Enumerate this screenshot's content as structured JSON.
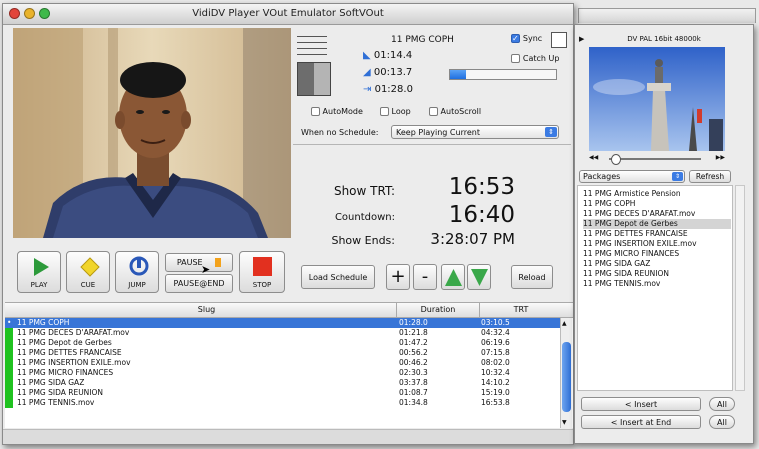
{
  "window": {
    "title": "VidiDV Player VOut Emulator SoftVOut"
  },
  "colors": {
    "accent_blue": "#3b7be3",
    "status_green": "#1fc21f",
    "selection": "#3875d7"
  },
  "status_panel": {
    "current_clip": "11 PMG COPH",
    "sync_label": "Sync",
    "sync_checked": true,
    "catchup_label": "Catch Up",
    "time_elapsed": "01:14.4",
    "time_remaining": "00:13.7",
    "time_duration": "01:28.0",
    "progress_fraction": 0.15,
    "automode_label": "AutoMode",
    "loop_label": "Loop",
    "autoscroll_label": "AutoScroll",
    "schedule_label": "When no Schedule:",
    "schedule_value": "Keep Playing Current"
  },
  "clock_panel": {
    "show_trt_label": "Show TRT:",
    "show_trt_value": "16:53",
    "countdown_label": "Countdown:",
    "countdown_value": "16:40",
    "show_ends_label": "Show Ends:",
    "show_ends_value": "3:28:07 PM"
  },
  "controls": {
    "play": "PLAY",
    "cue": "CUE",
    "jump": "JUMP",
    "pause": "PAUSE",
    "pause_end": "PAUSE@END",
    "stop": "STOP",
    "load_schedule": "Load Schedule",
    "plus": "+",
    "minus": "-",
    "reload": "Reload"
  },
  "table": {
    "columns": [
      "Slug",
      "Duration",
      "TRT"
    ],
    "rows": [
      {
        "slug": "11 PMG COPH",
        "duration": "01:28.0",
        "trt": "03:10.5",
        "selected": true
      },
      {
        "slug": "11 PMG DECES D'ARAFAT.mov",
        "duration": "01:21.8",
        "trt": "04:32.4"
      },
      {
        "slug": "11 PMG Depot de Gerbes",
        "duration": "01:47.2",
        "trt": "06:19.6"
      },
      {
        "slug": "11 PMG DETTES FRANCAISE",
        "duration": "00:56.2",
        "trt": "07:15.8"
      },
      {
        "slug": "11 PMG INSERTION EXILE.mov",
        "duration": "00:46.2",
        "trt": "08:02.0"
      },
      {
        "slug": "11 PMG MICRO FINANCES",
        "duration": "02:30.3",
        "trt": "10:32.4"
      },
      {
        "slug": "11 PMG SIDA GAZ",
        "duration": "03:37.8",
        "trt": "14:10.2"
      },
      {
        "slug": "11 PMG SIDA REUNION",
        "duration": "01:08.7",
        "trt": "15:19.0"
      },
      {
        "slug": "11 PMG TENNIS.mov",
        "duration": "01:34.8",
        "trt": "16:53.8"
      }
    ]
  },
  "right_panel": {
    "format_label": "DV PAL 16bit 48000k",
    "packages_select": "Packages",
    "refresh": "Refresh",
    "items": [
      "11 PMG Armistice Pension",
      "11 PMG COPH",
      "11 PMG DECES D'ARAFAT.mov",
      "11 PMG Depot de Gerbes",
      "11 PMG DETTES FRANCAISE",
      "11 PMG INSERTION EXILE.mov",
      "11 PMG MICRO FINANCES",
      "11 PMG SIDA GAZ",
      "11 PMG SIDA REUNION",
      "11 PMG TENNIS.mov"
    ],
    "selected_index": 3,
    "insert": "< Insert",
    "insert_end": "< Insert at End",
    "all": "All"
  }
}
